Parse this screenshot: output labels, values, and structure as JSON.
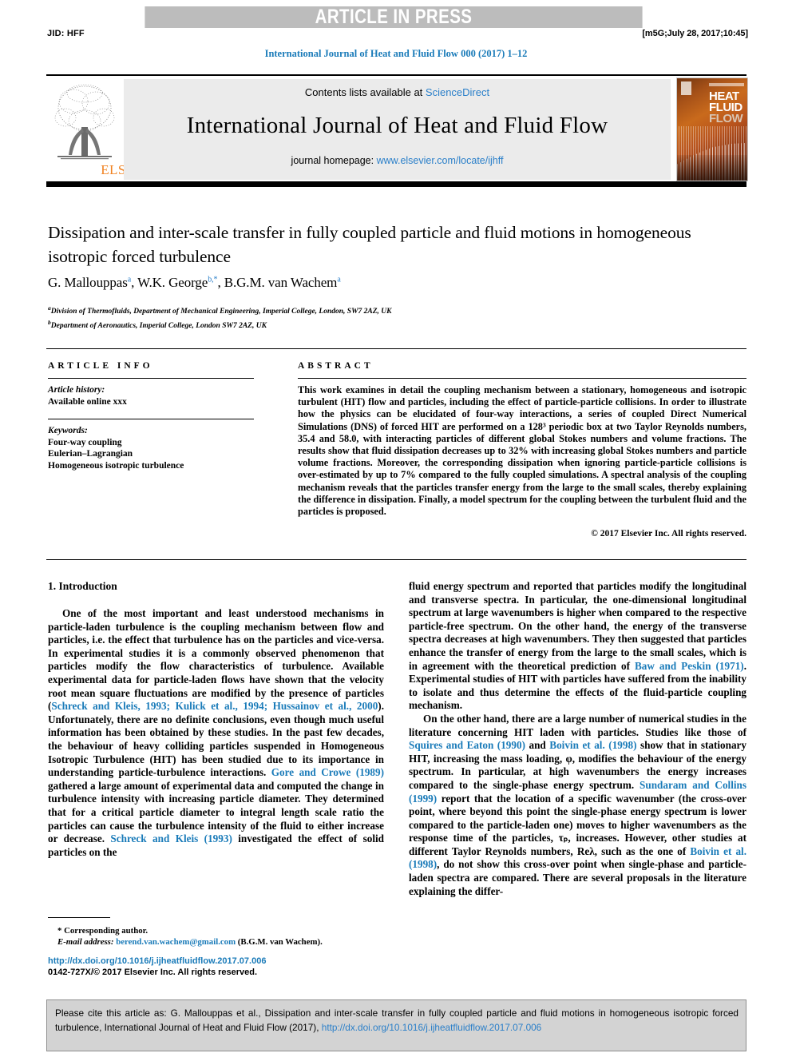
{
  "header": {
    "banner": "ARTICLE IN PRESS",
    "jid": "JID: HFF",
    "stamp": "[m5G;July 28, 2017;10:45]",
    "running_head": "International Journal of Heat and Fluid Flow 000 (2017) 1–12"
  },
  "journal_banner": {
    "contents_prefix": "Contents lists available at ",
    "sciencedirect": "ScienceDirect",
    "journal_title": "International Journal of Heat and Fluid Flow",
    "homepage_prefix": "journal homepage: ",
    "homepage_url": "www.elsevier.com/locate/ijhff",
    "publisher": "ELSEVIER",
    "cover": {
      "word1": "HEAT",
      "word2": "FLUID",
      "word3": "FLOW"
    }
  },
  "article": {
    "title": "Dissipation and inter-scale transfer in fully coupled particle and fluid motions in homogeneous isotropic forced turbulence",
    "authors_html": "G. Mallouppas<sup>a</sup>, W.K. George<sup>b,*</sup>, B.G.M. van Wachem<sup>a</sup>",
    "affiliation_a": "Division of Thermofluids, Department of Mechanical Engineering, Imperial College, London, SW7 2AZ, UK",
    "affiliation_b": "Department of Aeronautics, Imperial College, London SW7 2AZ, UK"
  },
  "info": {
    "heading": "ARTICLE INFO",
    "history_label": "Article history:",
    "history_value": "Available online xxx",
    "keywords_label": "Keywords:",
    "keywords": [
      "Four-way coupling",
      "Eulerian–Lagrangian",
      "Homogeneous isotropic turbulence"
    ]
  },
  "abstract": {
    "heading": "ABSTRACT",
    "text": "This work examines in detail the coupling mechanism between a stationary, homogeneous and isotropic turbulent (HIT) flow and particles, including the effect of particle-particle collisions. In order to illustrate how the physics can be elucidated of four-way interactions, a series of coupled Direct Numerical Simulations (DNS) of forced HIT are performed on a 128³ periodic box at two Taylor Reynolds numbers, 35.4 and 58.0, with interacting particles of different global Stokes numbers and volume fractions. The results show that fluid dissipation decreases up to 32% with increasing global Stokes numbers and particle volume fractions. Moreover, the corresponding dissipation when ignoring particle-particle collisions is over-estimated by up to 7% compared to the fully coupled simulations. A spectral analysis of the coupling mechanism reveals that the particles transfer energy from the large to the small scales, thereby explaining the difference in dissipation. Finally, a model spectrum for the coupling between the turbulent fluid and the particles is proposed.",
    "copyright": "© 2017 Elsevier Inc. All rights reserved."
  },
  "body": {
    "section_title": "1. Introduction",
    "left_paragraph_1_parts": [
      {
        "t": "One of the most important and least understood mechanisms in particle-laden turbulence is the coupling mechanism between flow and particles, i.e. the effect that turbulence has on the particles and vice-versa. In experimental studies it is a commonly observed phenomenon that particles modify the flow characteristics of turbulence. Available experimental data for particle-laden flows have shown that the velocity root mean square fluctuations are modified by the presence of particles (",
        "c": false
      },
      {
        "t": "Schreck and Kleis, 1993; Kulick et al., 1994; Hussainov et al., 2000",
        "c": true
      },
      {
        "t": "). Unfortunately, there are no definite conclusions, even though much useful information has been obtained by these studies. In the past few decades, the behaviour of heavy colliding particles suspended in Homogeneous Isotropic Turbulence (HIT) has been studied due to its importance in understanding particle-turbulence interactions. ",
        "c": false
      },
      {
        "t": "Gore and Crowe (1989)",
        "c": true
      },
      {
        "t": " gathered a large amount of experimental data and computed the change in turbulence intensity with increasing particle diameter. They determined that for a critical particle diameter to integral length scale ratio the particles can cause the turbulence intensity of the fluid to either increase or decrease. ",
        "c": false
      },
      {
        "t": "Schreck and Kleis (1993)",
        "c": true
      },
      {
        "t": " investigated the effect of solid particles on the",
        "c": false
      }
    ],
    "right_paragraph_1_parts": [
      {
        "t": "fluid energy spectrum and reported that particles modify the longitudinal and transverse spectra. In particular, the one-dimensional longitudinal spectrum at large wavenumbers is higher when compared to the respective particle-free spectrum. On the other hand, the energy of the transverse spectra decreases at high wavenumbers. They then suggested that particles enhance the transfer of energy from the large to the small scales, which is in agreement with the theoretical prediction of ",
        "c": false
      },
      {
        "t": "Baw and Peskin (1971)",
        "c": true
      },
      {
        "t": ". Experimental studies of HIT with particles have suffered from the inability to isolate and thus determine the effects of the fluid-particle coupling mechanism.",
        "c": false
      }
    ],
    "right_paragraph_2_parts": [
      {
        "t": "On the other hand, there are a large number of numerical studies in the literature concerning HIT laden with particles. Studies like those of ",
        "c": false
      },
      {
        "t": "Squires and Eaton (1990)",
        "c": true
      },
      {
        "t": " and ",
        "c": false
      },
      {
        "t": "Boivin et al. (1998)",
        "c": true
      },
      {
        "t": " show that in stationary HIT, increasing the mass loading, φ, modifies the behaviour of the energy spectrum. In particular, at high wavenumbers the energy increases compared to the single-phase energy spectrum. ",
        "c": false
      },
      {
        "t": "Sundaram and Collins (1999)",
        "c": true
      },
      {
        "t": " report that the location of a specific wavenumber (the cross-over point, where beyond this point the single-phase energy spectrum is lower compared to the particle-laden one) moves to higher wavenumbers as the response time of the particles, τₚ, increases. However, other studies at different Taylor Reynolds numbers, Reλ, such as the one of ",
        "c": false
      },
      {
        "t": "Boivin et al. (1998)",
        "c": true
      },
      {
        "t": ", do not show this cross-over point when single-phase and particle-laden spectra are compared. There are several proposals in the literature explaining the differ-",
        "c": false
      }
    ]
  },
  "footnote": {
    "corresponding": "* Corresponding author.",
    "email_label": "E-mail address:",
    "email": "berend.van.wachem@gmail.com",
    "email_suffix": "(B.G.M. van Wachem)."
  },
  "doi": {
    "url": "http://dx.doi.org/10.1016/j.ijheatfluidflow.2017.07.006",
    "issn_line": "0142-727X/© 2017 Elsevier Inc. All rights reserved."
  },
  "citation_footer": {
    "text": "Please cite this article as: G. Mallouppas et al., Dissipation and inter-scale transfer in fully coupled particle and fluid motions in homogeneous isotropic forced turbulence, International Journal of Heat and Fluid Flow (2017), ",
    "url": "http://dx.doi.org/10.1016/j.ijheatfluidflow.2017.07.006"
  },
  "colors": {
    "link_blue": "#1a7bb9",
    "banner_gray": "#bcbcbc",
    "elsevier_orange": "#f08221",
    "box_gray": "#d3d3d3"
  }
}
